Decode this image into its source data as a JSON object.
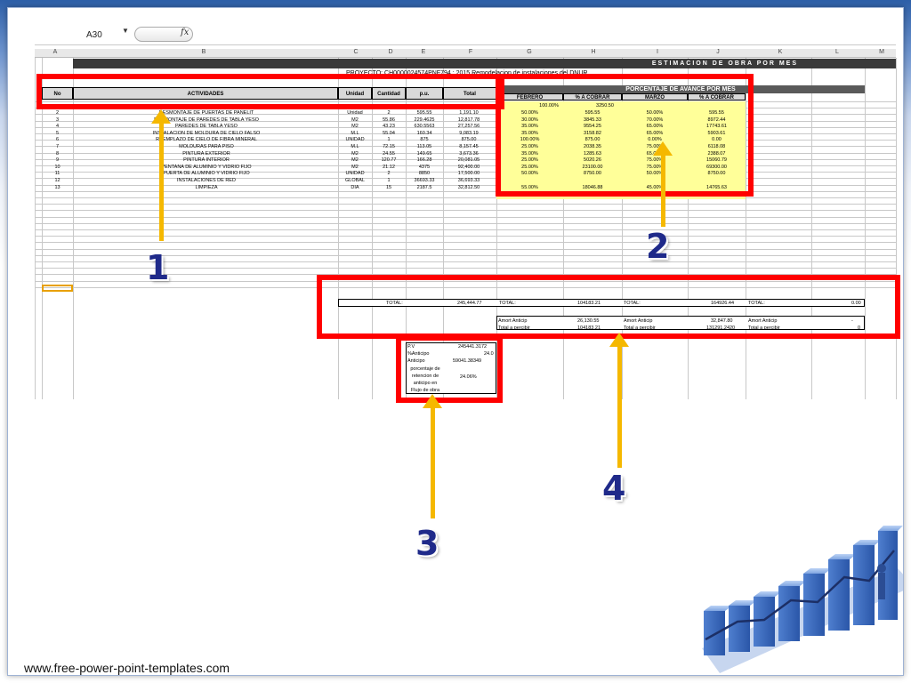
{
  "formula_bar": {
    "name_box": "A30",
    "fx_label": "fx"
  },
  "columns": [
    "A",
    "B",
    "C",
    "D",
    "E",
    "F",
    "G",
    "H",
    "I",
    "J",
    "K",
    "L",
    "M"
  ],
  "sheet": {
    "title": "ESTIMACION DE OBRA POR MES",
    "project": "PROYECTO: CH0000024574PNF794 : 2015 Remodelacion de instalaciones del DNUR",
    "headers": {
      "no": "No",
      "actividades": "ACTIVIDADES",
      "unidad": "Unidad",
      "cantidad": "Cantidad",
      "pu": "p.u.",
      "total": "Total"
    },
    "pct_header": "PORCENTAJE DE AVANCE POR MES",
    "months": [
      "FEBRERO",
      "% A COBRAR",
      "MARZO",
      "% A COBRAR"
    ],
    "first_row": {
      "g": "100.00%",
      "h": "3250.50"
    },
    "rows": [
      {
        "no": "2",
        "act": "DESMONTAJE DE PUERTAS DE PANELIT",
        "u": "Unidad",
        "c": "2",
        "pu": "595.55",
        "t": "1,191.10",
        "g": "50.00%",
        "h": "595.55",
        "i": "50.00%",
        "j": "595.55"
      },
      {
        "no": "3",
        "act": "DESMONTAJE DE PAREDES DE TABLA YESO",
        "u": "M2",
        "c": "55.86",
        "pu": "229.4625",
        "t": "12,817.78",
        "g": "30.00%",
        "h": "3845.33",
        "i": "70.00%",
        "j": "8972.44"
      },
      {
        "no": "4",
        "act": "PAREDES DE TABLA YESO",
        "u": "M2",
        "c": "43.23",
        "pu": "630.5563",
        "t": "27,257.56",
        "g": "35.00%",
        "h": "9554.25",
        "i": "65.00%",
        "j": "17743.61"
      },
      {
        "no": "5",
        "act": "INSTALACION DE MOLDURA DE CIELO FALSO",
        "u": "M.L",
        "c": "55.04",
        "pu": "160.34",
        "t": "9,083.19",
        "g": "35.00%",
        "h": "3158.82",
        "i": "65.00%",
        "j": "5903.61"
      },
      {
        "no": "6",
        "act": "REEMPLAZO DE CIELO DE FIBRA MINERAL",
        "u": "UNIDAD",
        "c": "1",
        "pu": "875",
        "t": "875.00",
        "g": "100.00%",
        "h": "875.00",
        "i": "0.00%",
        "j": "0.00"
      },
      {
        "no": "7",
        "act": "MOLDURAS PARA PISO",
        "u": "M.L",
        "c": "72.15",
        "pu": "113.05",
        "t": "8,157.45",
        "g": "25.00%",
        "h": "2038.35",
        "i": "75.00%",
        "j": "6118.08"
      },
      {
        "no": "8",
        "act": "PINTURA EXTERIOR",
        "u": "M2",
        "c": "24.55",
        "pu": "149.65",
        "t": "3,673.36",
        "g": "35.00%",
        "h": "1285.63",
        "i": "65.00%",
        "j": "2388.07"
      },
      {
        "no": "9",
        "act": "PINTURA INTERIOR",
        "u": "M2",
        "c": "120.77",
        "pu": "166.28",
        "t": "20,081.05",
        "g": "25.00%",
        "h": "5020.26",
        "i": "75.00%",
        "j": "15060.79"
      },
      {
        "no": "10",
        "act": "VENTANA DE ALUMINIO Y VIDRIO FIJO",
        "u": "M2",
        "c": "21.12",
        "pu": "4375",
        "t": "92,400.00",
        "g": "25.00%",
        "h": "23100.00",
        "i": "75.00%",
        "j": "69300.00"
      },
      {
        "no": "11",
        "act": "PUERTA DE ALUMINIO Y VIDRIO FIJO",
        "u": "UNIDAD",
        "c": "2",
        "pu": "8850",
        "t": "17,500.00",
        "g": "50.00%",
        "h": "8750.00",
        "i": "50.00%",
        "j": "8750.00"
      },
      {
        "no": "12",
        "act": "INSTALACIONES DE RED",
        "u": "GLOBAL",
        "c": "1",
        "pu": "36693.33",
        "t": "36,693.33",
        "g": "",
        "h": "",
        "i": "",
        "j": ""
      },
      {
        "no": "13",
        "act": "LIMPIEZA",
        "u": "DIA",
        "c": "15",
        "pu": "2187.5",
        "t": "32,812.50",
        "g": "55.00%",
        "h": "18046.88",
        "i": "45.00%",
        "j": "14765.63"
      }
    ],
    "totals": {
      "total_label": "TOTAL:",
      "total_value": "245,444.77",
      "feb_label": "TOTAL:",
      "feb_value": "104183.21",
      "mar_label": "TOTAL:",
      "mar_value": "164926.44",
      "k_label": "TOTAL:",
      "k_value": "0.00"
    },
    "amort": {
      "label1": "Amort Anticip",
      "v1": "26,130.55",
      "label2": "Amort Anticip",
      "v2": "32,847.80",
      "label3": "Amort Anticip",
      "v3": "-",
      "label4": "Total a percibir",
      "v4": "104183.21",
      "label5": "Total a percibir",
      "v5": "131291.2420",
      "label6": "Total a percibir",
      "v6": "0"
    },
    "advance": {
      "pv_label": "P.V",
      "pv_value": "245441.3172",
      "adv_pct_label": "%Anticipo",
      "adv_pct_value": "24.0",
      "anticipo_label": "Anticipo",
      "anticipo_value": "59041.38349",
      "porc_label": "porcentaje de retencion de anticipo en Flujo de obra",
      "porc_value": "24.06%"
    }
  },
  "callouts": [
    "1",
    "2",
    "3",
    "4"
  ],
  "footer": "www.free-power-point-templates.com",
  "colors": {
    "highlight": "#ff0000",
    "arrow": "#f5b800",
    "number": "#1f2a8a",
    "yellow": "#ffff99"
  }
}
